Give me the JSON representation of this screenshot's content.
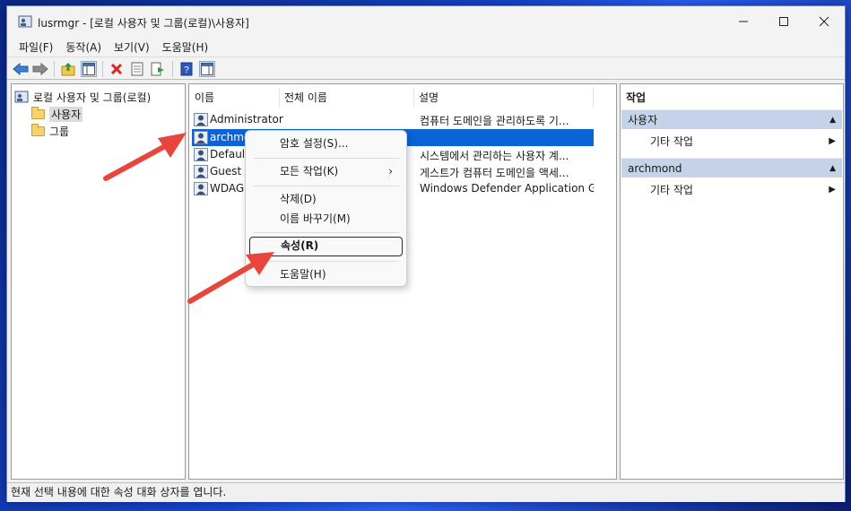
{
  "window": {
    "title": "lusrmgr - [로컬 사용자 및 그룹(로컬)\\사용자]"
  },
  "menubar": {
    "items": [
      "파일(F)",
      "동작(A)",
      "보기(V)",
      "도움말(H)"
    ]
  },
  "tree": {
    "root": "로컬 사용자 및 그룹(로컬)",
    "items": [
      "사용자",
      "그룹"
    ]
  },
  "list": {
    "columns": [
      "이름",
      "전체 이름",
      "설명"
    ],
    "rows": [
      {
        "name": "Administrator",
        "fullname": "",
        "desc": "컴퓨터 도메인을 관리하도록 기..."
      },
      {
        "name": "archmond",
        "fullname": "archmond",
        "desc": ""
      },
      {
        "name": "Default",
        "fullname": "",
        "desc": "시스템에서 관리하는 사용자 계..."
      },
      {
        "name": "Guest",
        "fullname": "",
        "desc": "게스트가 컴퓨터 도메인을 액세..."
      },
      {
        "name": "WDAGU",
        "fullname": "",
        "desc": "Windows Defender Application G..."
      }
    ]
  },
  "actions": {
    "header": "작업",
    "group1": {
      "title": "사용자",
      "item": "기타 작업"
    },
    "group2": {
      "title": "archmond",
      "item": "기타 작업"
    }
  },
  "context_menu": {
    "items": [
      "암호 설정(S)...",
      "모든 작업(K)",
      "삭제(D)",
      "이름 바꾸기(M)",
      "속성(R)",
      "도움말(H)"
    ]
  },
  "status": {
    "text": "현재 선택 내용에 대한 속성 대화 상자를 엽니다."
  },
  "colors": {
    "selection": "#0a64d8",
    "accent_arrow": "#e8453c",
    "action_bar": "#c5d3e8"
  }
}
